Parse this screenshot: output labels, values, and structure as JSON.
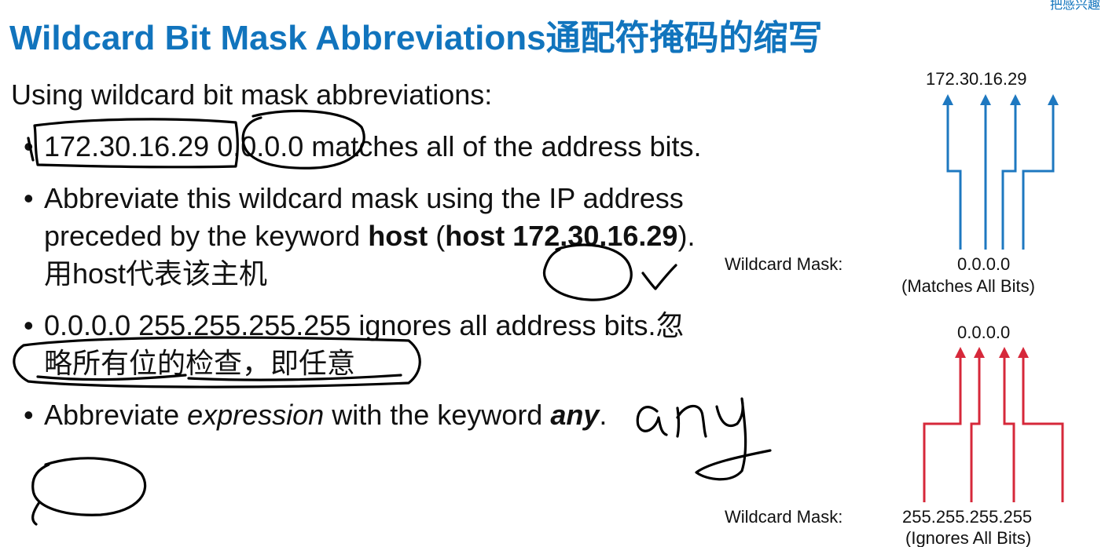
{
  "slide": {
    "title": "Wildcard Bit Mask Abbreviations通配符掩码的缩写",
    "corner_text": "把感兴趣",
    "intro": "Using wildcard bit mask abbreviations:"
  },
  "bullets": [
    {
      "parts": [
        {
          "text": "172.30.16.29 0.0.0.0 matches all of the address bits.",
          "style": "normal"
        }
      ]
    },
    {
      "parts": [
        {
          "text": "Abbreviate this wildcard mask using the IP address preceded by the keyword ",
          "style": "normal"
        },
        {
          "text": "host",
          "style": "bold"
        },
        {
          "text": " (",
          "style": "normal"
        },
        {
          "text": "host 172.30.16.29",
          "style": "bold"
        },
        {
          "text": ").用host代表该主机",
          "style": "normal"
        }
      ]
    },
    {
      "parts": [
        {
          "text": "0.0.0.0 255.255.255.255 ignores all address bits.忽略所有位的检查，即任意",
          "style": "normal"
        }
      ]
    },
    {
      "parts": [
        {
          "text": "Abbreviate ",
          "style": "normal"
        },
        {
          "text": "expression",
          "style": "italic"
        },
        {
          "text": " with the keyword ",
          "style": "normal"
        },
        {
          "text": "any",
          "style": "bolditalic"
        },
        {
          "text": ".",
          "style": "normal"
        }
      ]
    }
  ],
  "bullet_symbol": "•",
  "diagram_top": {
    "address": "172.30.16.29",
    "mask_label": "Wildcard Mask:",
    "mask_value": "0.0.0.0",
    "caption": "(Matches All Bits)",
    "line_color": "#1e78c0"
  },
  "diagram_bottom": {
    "address": "0.0.0.0",
    "mask_label": "Wildcard Mask:",
    "mask_value": "255.255.255.255",
    "caption": "(Ignores All Bits)",
    "line_color": "#d6283a"
  },
  "annotations": {
    "handwritten_any": "any",
    "ink_color": "#000000"
  }
}
